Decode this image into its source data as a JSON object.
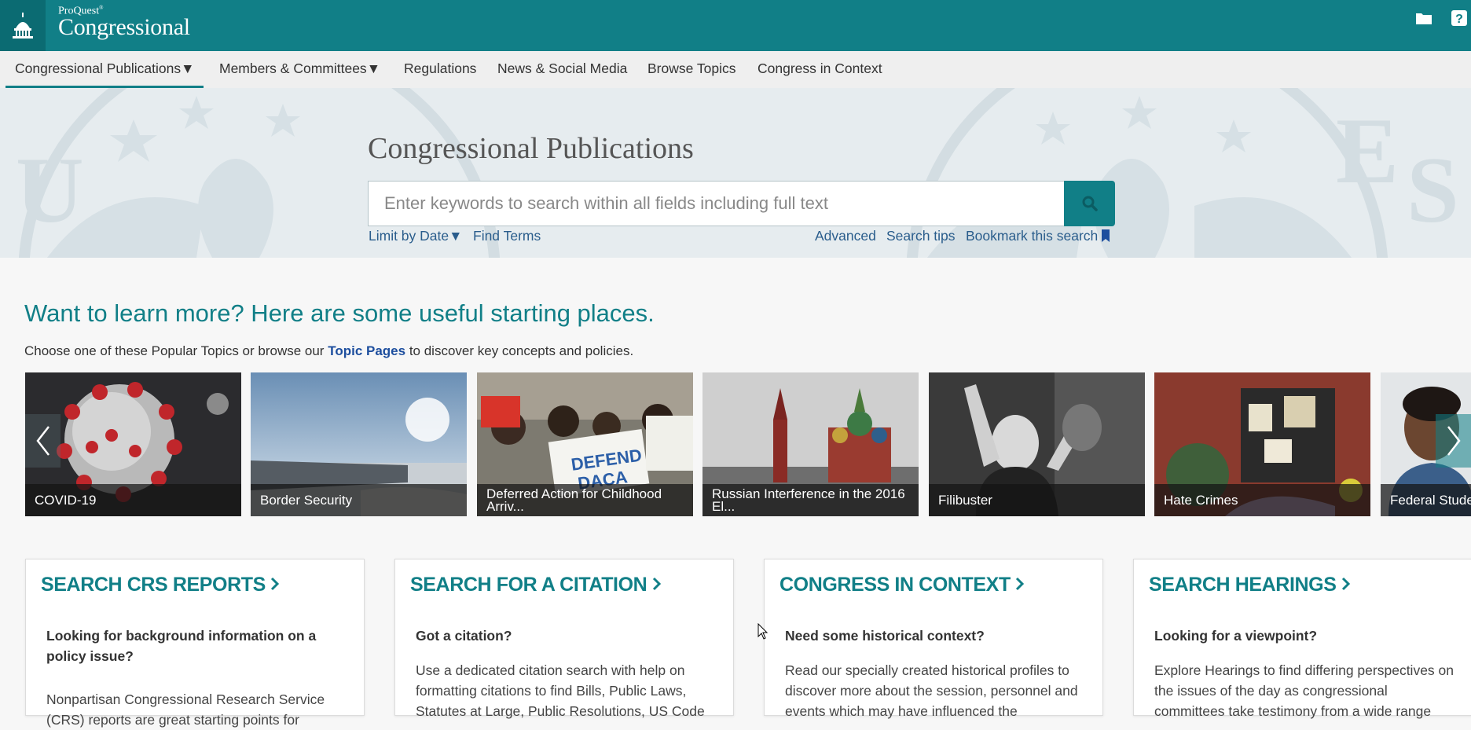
{
  "brand": {
    "small": "ProQuest",
    "small_mark": "®",
    "big": "Congressional"
  },
  "nav": {
    "items": [
      {
        "label": "Congressional Publications",
        "dropdown": true,
        "active": true
      },
      {
        "label": "Members & Committees",
        "dropdown": true
      },
      {
        "label": "Regulations"
      },
      {
        "label": "News & Social Media"
      },
      {
        "label": "Browse Topics"
      },
      {
        "label": "Congress in Context"
      }
    ],
    "caret": "▼"
  },
  "hero": {
    "title": "Congressional Publications",
    "search_placeholder": "Enter keywords to search within all fields including full text",
    "links_left": [
      "Limit by Date",
      "Find Terms"
    ],
    "links_right": [
      "Advanced",
      "Search tips",
      "Bookmark this search"
    ]
  },
  "learn": {
    "title": "Want to learn more? Here are some useful starting places.",
    "sub_before": "Choose one of these Popular Topics or browse our ",
    "sub_link": "Topic Pages",
    "sub_after": " to discover key concepts and policies."
  },
  "topics": [
    {
      "label": "COVID-19"
    },
    {
      "label": "Border Security"
    },
    {
      "label": "Deferred Action for Childhood Arriv..."
    },
    {
      "label": "Russian Interference in the 2016 El..."
    },
    {
      "label": "Filibuster"
    },
    {
      "label": "Hate Crimes"
    },
    {
      "label": "Federal Stude"
    }
  ],
  "panels": [
    {
      "title": "SEARCH CRS REPORTS",
      "question": "Looking for background information on a policy issue?",
      "body": "Nonpartisan Congressional Research Service (CRS) reports are great starting points for"
    },
    {
      "title": "SEARCH FOR A CITATION",
      "question": "Got a citation?",
      "body": "Use a dedicated citation search with help on formatting citations to find Bills, Public Laws, Statutes at Large, Public Resolutions, US Code"
    },
    {
      "title": "CONGRESS IN CONTEXT",
      "question": "Need some historical context?",
      "body": "Read our specially created historical profiles to discover more about the session, personnel and events which may have influenced the"
    },
    {
      "title": "SEARCH HEARINGS",
      "question": "Looking for a viewpoint?",
      "body": "Explore Hearings to find differing perspectives on the issues of the day as congressional committees take testimony from a wide range"
    }
  ],
  "colors": {
    "teal": "#117f87",
    "teal_dark": "#0b6b72",
    "link": "#2a5d8c"
  }
}
